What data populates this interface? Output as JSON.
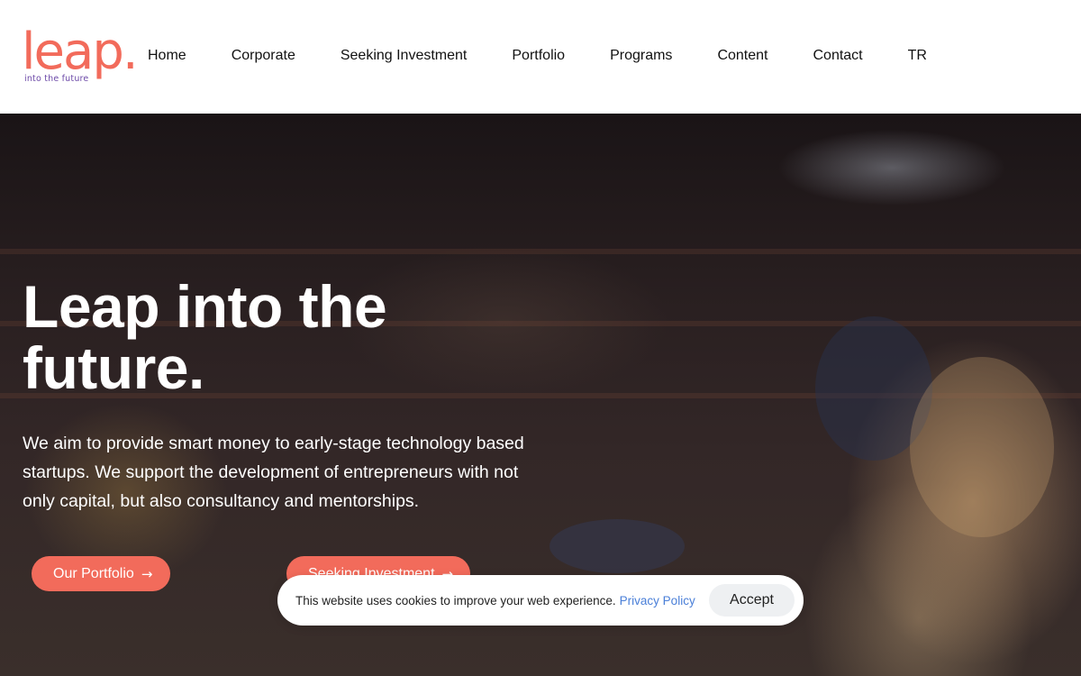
{
  "brand": {
    "logo_text": "leap.",
    "tagline": "into the future"
  },
  "nav": {
    "items": [
      {
        "label": "Home"
      },
      {
        "label": "Corporate"
      },
      {
        "label": "Seeking Investment"
      },
      {
        "label": "Portfolio"
      },
      {
        "label": "Programs"
      },
      {
        "label": "Content"
      },
      {
        "label": "Contact"
      },
      {
        "label": "TR"
      }
    ]
  },
  "hero": {
    "title_line1": "Leap into the",
    "title_line2": "future.",
    "description": "We aim to provide smart money to early-stage technology based startups. We support the development of entrepreneurs with not only capital, but also consultancy and mentorships.",
    "buttons": {
      "portfolio": {
        "label": "Our Portfolio",
        "icon": "arrow-right-icon"
      },
      "investment": {
        "label": "Seeking Investment",
        "icon": "arrow-right-icon"
      }
    }
  },
  "cookie": {
    "message": "This website uses cookies to improve your web experience.",
    "policy_link": "Privacy Policy",
    "accept_label": "Accept"
  },
  "colors": {
    "accent": "#f26b5b",
    "tagline": "#6d4aa8",
    "link": "#4a7fd8"
  }
}
